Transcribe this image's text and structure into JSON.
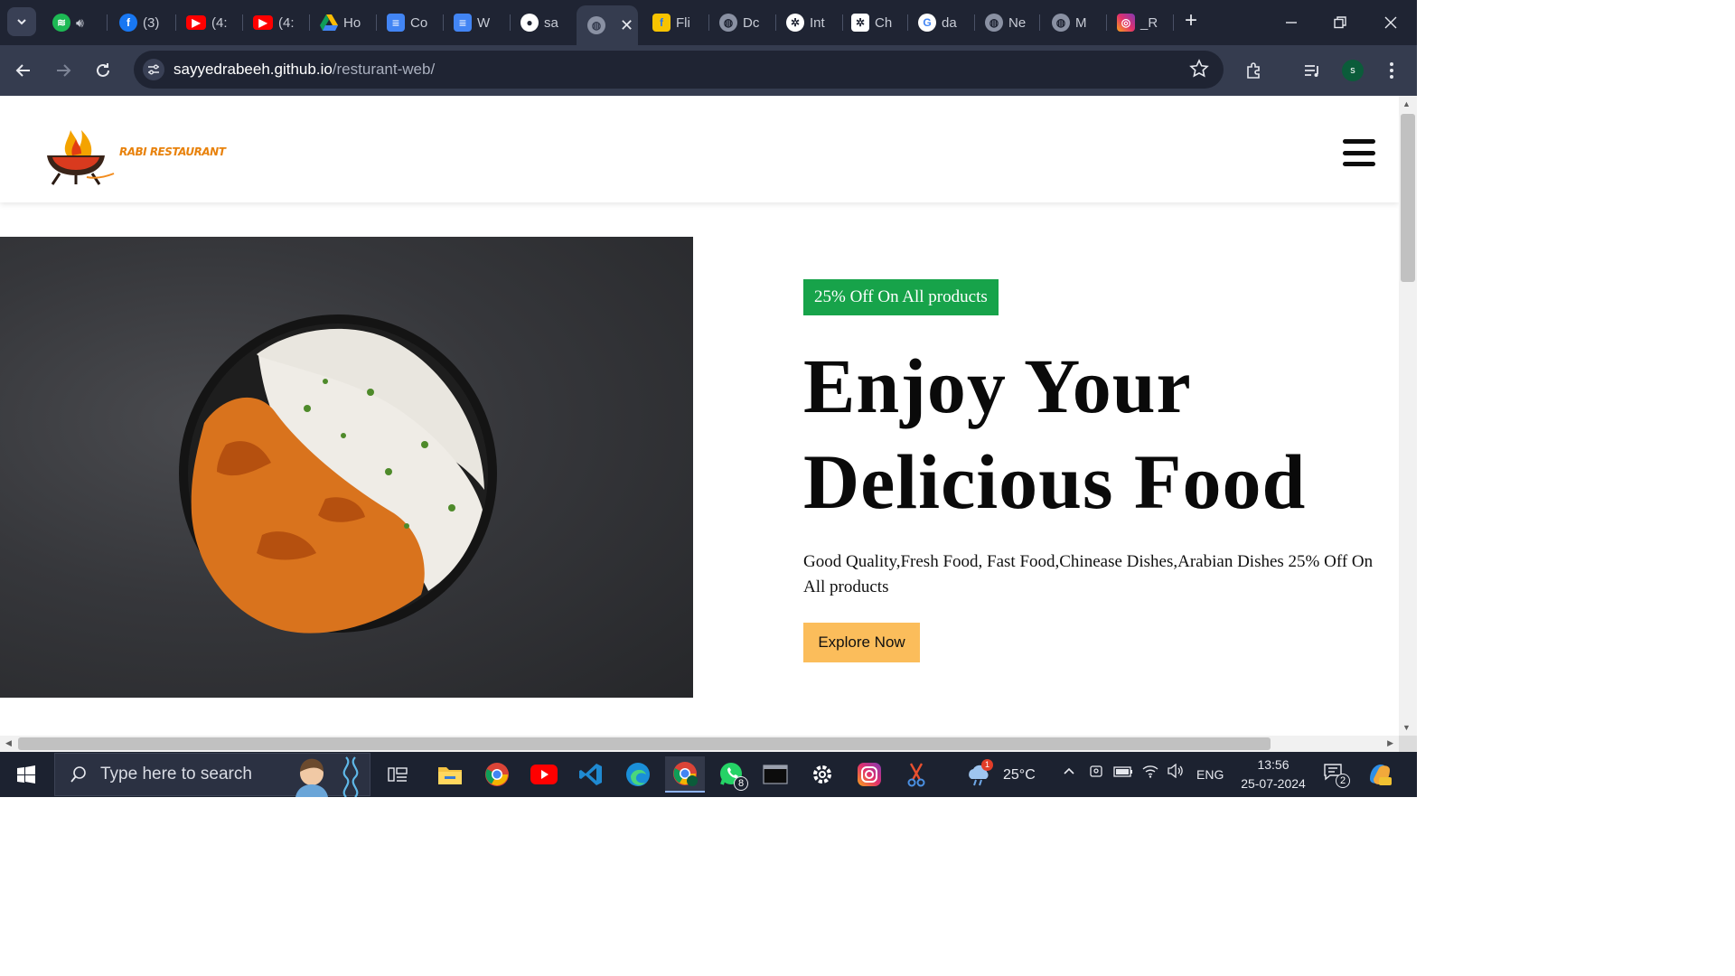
{
  "browser": {
    "tabs": [
      {
        "title": "",
        "icon": "spotify-icon"
      },
      {
        "title": "(3)",
        "icon": "facebook-icon"
      },
      {
        "title": "(4:",
        "icon": "youtube-icon"
      },
      {
        "title": "(4:",
        "icon": "youtube-icon"
      },
      {
        "title": "Ho",
        "icon": "google-drive-icon"
      },
      {
        "title": "Co",
        "icon": "google-docs-icon"
      },
      {
        "title": "W",
        "icon": "google-docs-icon"
      },
      {
        "title": "sa",
        "icon": "github-icon"
      },
      {
        "title": "",
        "icon": "globe-icon",
        "active": true
      },
      {
        "title": "Fli",
        "icon": "flipkart-icon"
      },
      {
        "title": "Dc",
        "icon": "globe-icon"
      },
      {
        "title": "Int",
        "icon": "openai-icon"
      },
      {
        "title": "Ch",
        "icon": "openai-icon"
      },
      {
        "title": "da",
        "icon": "google-icon"
      },
      {
        "title": "Ne",
        "icon": "globe-icon"
      },
      {
        "title": "M",
        "icon": "globe-icon"
      },
      {
        "title": "_R",
        "icon": "instagram-icon"
      }
    ],
    "url_host": "sayyedrabeeh.github.io",
    "url_path": "/resturant-web/",
    "profile_initial": "s"
  },
  "site": {
    "logo_text": "RABI RESTAURANT",
    "badge": "25% Off On All products",
    "title_line1": "Enjoy Your",
    "title_line2": "Delicious Food",
    "description": "Good Quality,Fresh Food, Fast Food,Chinease Dishes,Arabian Dishes 25% Off On All products",
    "cta": "Explore Now"
  },
  "taskbar": {
    "search_placeholder": "Type here to search",
    "weather_temp": "25°C",
    "weather_badge": "1",
    "whatsapp_badge": "8",
    "language": "ENG",
    "time": "13:56",
    "date": "25-07-2024",
    "notification_count": "2"
  },
  "colors": {
    "badge_green": "#17a34a",
    "cta_orange": "#fbbd5b",
    "chrome_dark": "#1f2433"
  }
}
